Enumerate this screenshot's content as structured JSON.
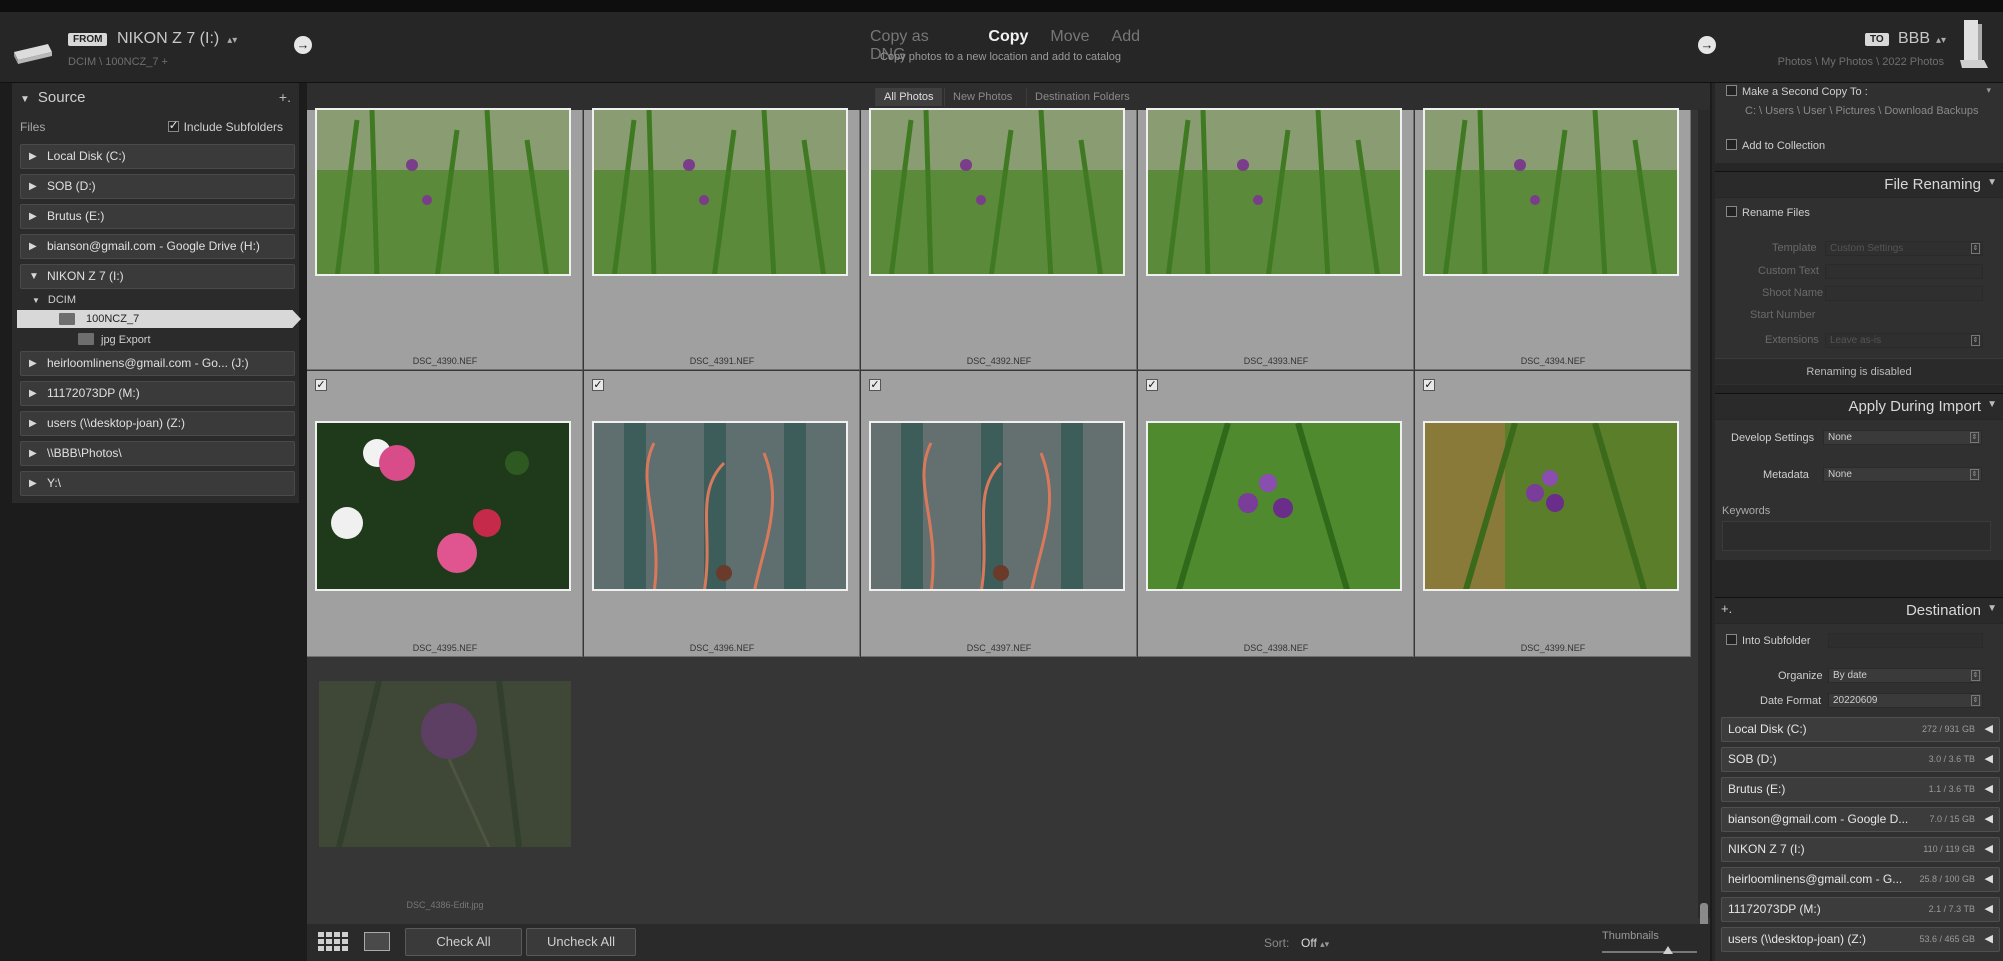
{
  "header": {
    "from_tag": "FROM",
    "from_name": "NIKON Z 7   (I:)",
    "from_path": "DCIM \\ 100NCZ_7 +",
    "modes": [
      "Copy as DNG",
      "Copy",
      "Move",
      "Add"
    ],
    "active_mode": "Copy",
    "mode_description": "Copy photos to a new location and add to catalog",
    "to_tag": "TO",
    "to_name": "BBB",
    "to_path": "Photos \\ My Photos \\ 2022 Photos"
  },
  "source": {
    "title": "Source",
    "plus": "+.",
    "files_label": "Files",
    "include_subfolders": "Include Subfolders",
    "volumes": [
      "Local Disk (C:)",
      "SOB (D:)",
      "Brutus (E:)",
      "bianson@gmail.com - Google Drive (H:)",
      "NIKON Z 7   (I:)",
      "heirloomlinens@gmail.com - Go... (J:)",
      "11172073DP (M:)",
      "users (\\\\desktop-joan) (Z:)",
      "\\\\BBB\\Photos\\",
      "Y:\\"
    ],
    "dcim": "DCIM",
    "selected_folder": "100NCZ_7",
    "subfolder": "jpg Export"
  },
  "view_tabs": [
    "All Photos",
    "New Photos",
    "Destination Folders"
  ],
  "photos": [
    "DSC_4390.NEF",
    "DSC_4391.NEF",
    "DSC_4392.NEF",
    "DSC_4393.NEF",
    "DSC_4394.NEF",
    "DSC_4395.NEF",
    "DSC_4396.NEF",
    "DSC_4397.NEF",
    "DSC_4398.NEF",
    "DSC_4399.NEF",
    "DSC_4386-Edit.jpg"
  ],
  "toolbar": {
    "check_all": "Check All",
    "uncheck_all": "Uncheck All",
    "sort_label": "Sort:",
    "sort_value": "Off",
    "thumbnails_label": "Thumbnails",
    "thumbnail_size": 0.65
  },
  "right": {
    "second_copy": "Make a Second Copy To :",
    "second_copy_path": "C: \\ Users \\ User \\ Pictures \\ Download Backups",
    "add_collection": "Add to Collection",
    "file_renaming": "File Renaming",
    "rename_files": "Rename Files",
    "template_label": "Template",
    "template_value": "Custom Settings",
    "custom_text": "Custom Text",
    "shoot_name": "Shoot Name",
    "start_number": "Start Number",
    "extensions_label": "Extensions",
    "extensions_value": "Leave as-is",
    "renaming_disabled": "Renaming is disabled",
    "apply_during_import": "Apply During Import",
    "develop_settings": "Develop Settings",
    "develop_value": "None",
    "metadata": "Metadata",
    "metadata_value": "None",
    "keywords": "Keywords",
    "destination": "Destination",
    "dest_plus": "+.",
    "into_subfolder": "Into Subfolder",
    "organize_label": "Organize",
    "organize_value": "By date",
    "date_format_label": "Date Format",
    "date_format_value": "20220609",
    "dest_volumes": [
      {
        "name": "Local Disk (C:)",
        "cap": "272 / 931 GB"
      },
      {
        "name": "SOB (D:)",
        "cap": "3.0 / 3.6 TB"
      },
      {
        "name": "Brutus (E:)",
        "cap": "1.1 / 3.6 TB"
      },
      {
        "name": "bianson@gmail.com - Google D...",
        "cap": "7.0 / 15 GB"
      },
      {
        "name": "NIKON Z 7   (I:)",
        "cap": "110 / 119 GB"
      },
      {
        "name": "heirloomlinens@gmail.com - G...",
        "cap": "25.8 / 100 GB"
      },
      {
        "name": "11172073DP (M:)",
        "cap": "2.1 / 7.3 TB"
      },
      {
        "name": "users (\\\\desktop-joan) (Z:)",
        "cap": "53.6 / 465 GB"
      }
    ]
  }
}
